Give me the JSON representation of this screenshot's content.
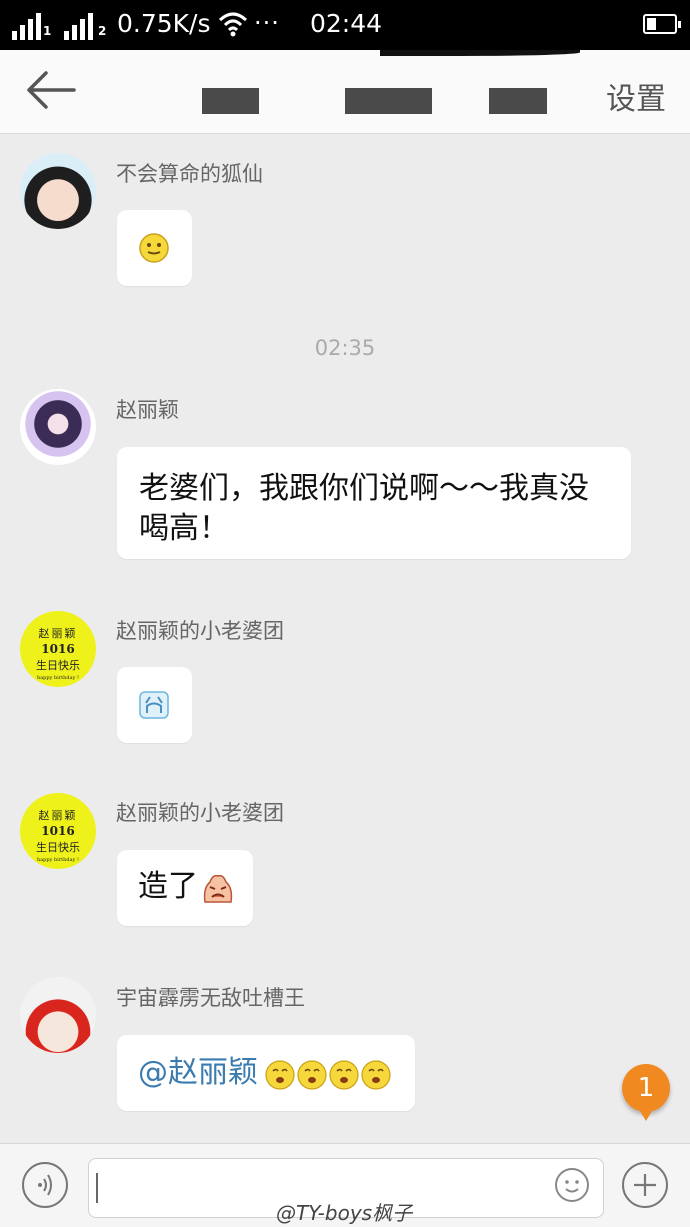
{
  "status_bar": {
    "sim1": "1",
    "sim2": "2",
    "network_speed": "0.75K/s",
    "more_dots": "···",
    "time": "02:44"
  },
  "nav": {
    "settings_label": "设置"
  },
  "messages": [
    {
      "sender": "不会算命的狐仙",
      "text": "",
      "emoji": "slight-smile-emoji"
    },
    {
      "sender": "赵丽颖",
      "text": "老婆们，我跟你们说啊～～我真没喝高！"
    },
    {
      "sender": "赵丽颖的小老婆团",
      "text": "",
      "emoji": "crying-face-emoji"
    },
    {
      "sender": "赵丽颖的小老婆团",
      "text": "造了",
      "emoji": "angry-face-emoji"
    },
    {
      "sender": "宇宙霹雳无敌吐槽王",
      "mention": "@赵丽颖",
      "emoji": "giggle-face-emoji"
    }
  ],
  "timestamp": "02:35",
  "avatar_text": {
    "line1": "赵丽颖",
    "line2": "1016",
    "line3": "生日快乐",
    "line4": "happy birthday !"
  },
  "unread_count": "1",
  "watermark": "@TY-boys枫子"
}
